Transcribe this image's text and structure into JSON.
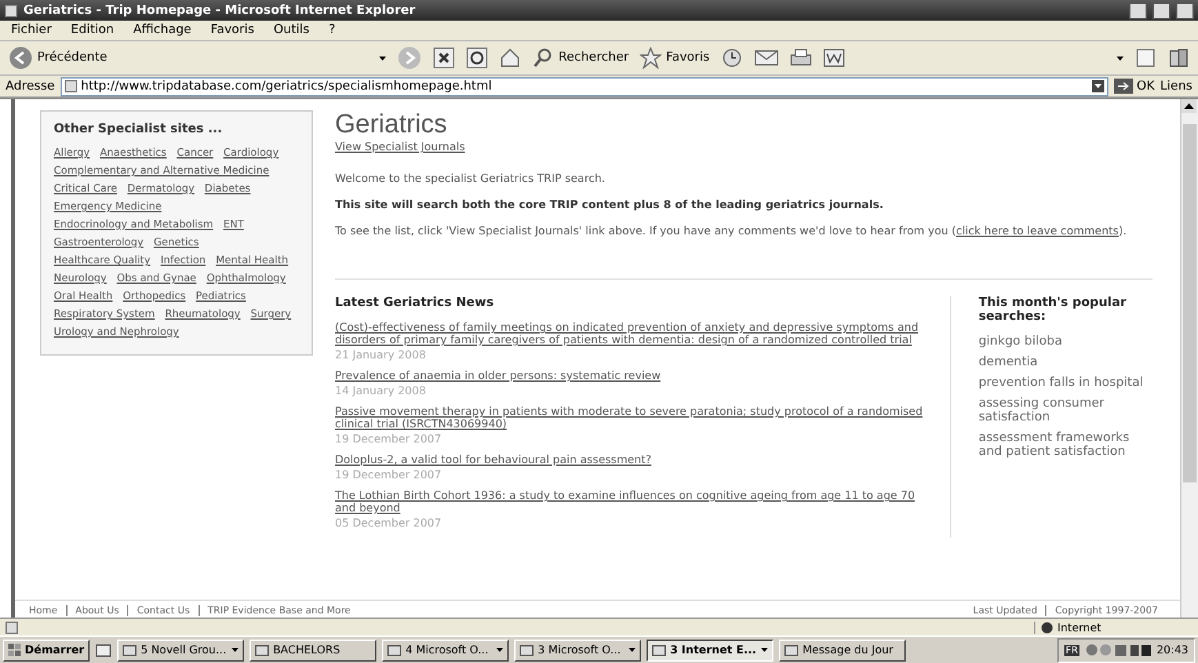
{
  "window": {
    "title": "Geriatrics - Trip Homepage - Microsoft Internet Explorer"
  },
  "menu": [
    "Fichier",
    "Edition",
    "Affichage",
    "Favoris",
    "Outils",
    "?"
  ],
  "toolbar": {
    "back": "Précédente",
    "search": "Rechercher",
    "favorites": "Favoris"
  },
  "address_bar": {
    "label": "Adresse",
    "value": "http://www.tripdatabase.com/geriatrics/specialismhomepage.html",
    "go": "OK",
    "links": "Liens"
  },
  "sidebar": {
    "title": "Other Specialist sites ...",
    "links": [
      "Allergy",
      "Anaesthetics",
      "Cancer",
      "Cardiology",
      "Complementary and Alternative Medicine",
      "Critical Care",
      "Dermatology",
      "Diabetes",
      "Emergency Medicine",
      "Endocrinology and Metabolism",
      "ENT",
      "Gastroenterology",
      "Genetics",
      "Healthcare Quality",
      "Infection",
      "Mental Health",
      "Neurology",
      "Obs and Gynae",
      "Ophthalmology",
      "Oral Health",
      "Orthopedics",
      "Pediatrics",
      "Respiratory System",
      "Rheumatology",
      "Surgery",
      "Urology and Nephrology"
    ]
  },
  "page": {
    "title": "Geriatrics",
    "journals_link": "View Specialist Journals",
    "welcome": "Welcome to the specialist Geriatrics TRIP search.",
    "summary": "This site will search both the core TRIP content plus 8 of the leading geriatrics journals.",
    "info": "To see the list, click 'View Specialist Journals' link above.  If you have any comments we'd love to hear from you (",
    "info_link": "click here to leave comments",
    "info_end": ")."
  },
  "news": {
    "title": "Latest Geriatrics News",
    "items": [
      {
        "title": "(Cost)-effectiveness of family meetings on indicated prevention of anxiety and depressive symptoms and disorders of primary family caregivers of patients with dementia: design of a randomized controlled trial",
        "date": "21 January 2008"
      },
      {
        "title": "Prevalence of anaemia in older persons: systematic review",
        "date": "14 January 2008"
      },
      {
        "title": "Passive movement therapy in patients with moderate to severe paratonia; study protocol of a randomised clinical trial (ISRCTN43069940)",
        "date": "19 December 2007"
      },
      {
        "title": "Doloplus-2, a valid tool for behavioural pain assessment?",
        "date": "19 December 2007"
      },
      {
        "title": "The Lothian Birth Cohort 1936: a study to examine influences on cognitive ageing from age 11 to age 70 and beyond",
        "date": "05 December 2007"
      }
    ]
  },
  "searches": {
    "title": "This month's popular searches:",
    "items": [
      "ginkgo biloba",
      "dementia",
      "prevention falls in hospital",
      "assessing consumer satisfaction",
      "assessment frameworks and patient satisfaction"
    ]
  },
  "footer": {
    "left": [
      "Home",
      "About Us",
      "Contact Us",
      "TRIP Evidence Base and More"
    ],
    "right": [
      "Last Updated",
      "Copyright 1997-2007"
    ]
  },
  "status_bar": {
    "zone": "Internet"
  },
  "taskbar": {
    "start": "Démarrer",
    "tasks": [
      {
        "label": "5 Novell Grou...",
        "kind": "group",
        "selected": false
      },
      {
        "label": "BACHELORS",
        "kind": "single",
        "selected": false
      },
      {
        "label": "4 Microsoft O...",
        "kind": "group",
        "selected": false
      },
      {
        "label": "3 Microsoft O...",
        "kind": "group",
        "selected": false
      },
      {
        "label": "3 Internet E...",
        "kind": "group",
        "selected": true
      },
      {
        "label": "Message du Jour",
        "kind": "single",
        "selected": false
      }
    ],
    "language": "FR",
    "clock": "20:43"
  }
}
